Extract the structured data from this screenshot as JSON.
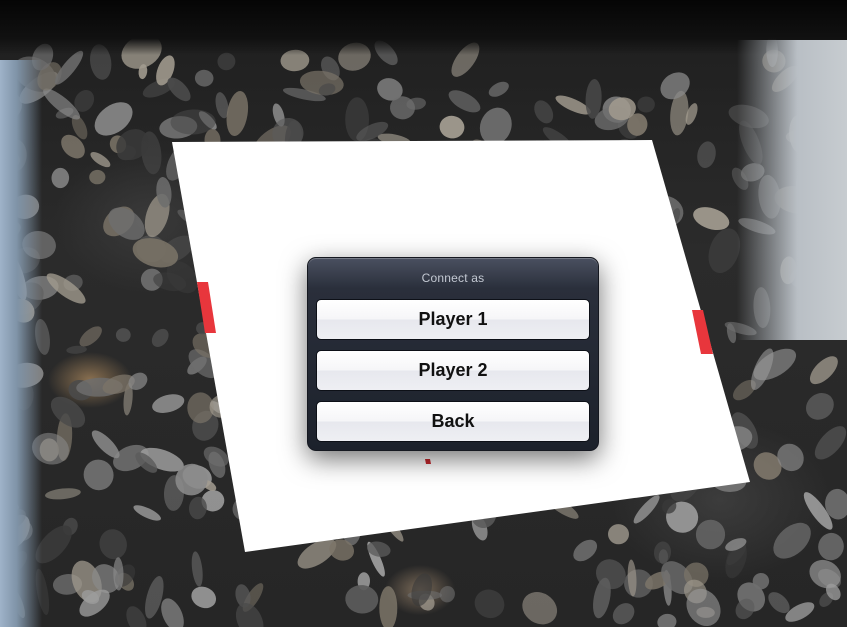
{
  "dialog": {
    "title": "Connect as",
    "buttons": [
      {
        "label": "Player 1"
      },
      {
        "label": "Player 2"
      },
      {
        "label": "Back"
      }
    ]
  },
  "colors": {
    "paddle": "#e8363c",
    "board": "#ffffff",
    "dialog_background": "#1c212b"
  }
}
